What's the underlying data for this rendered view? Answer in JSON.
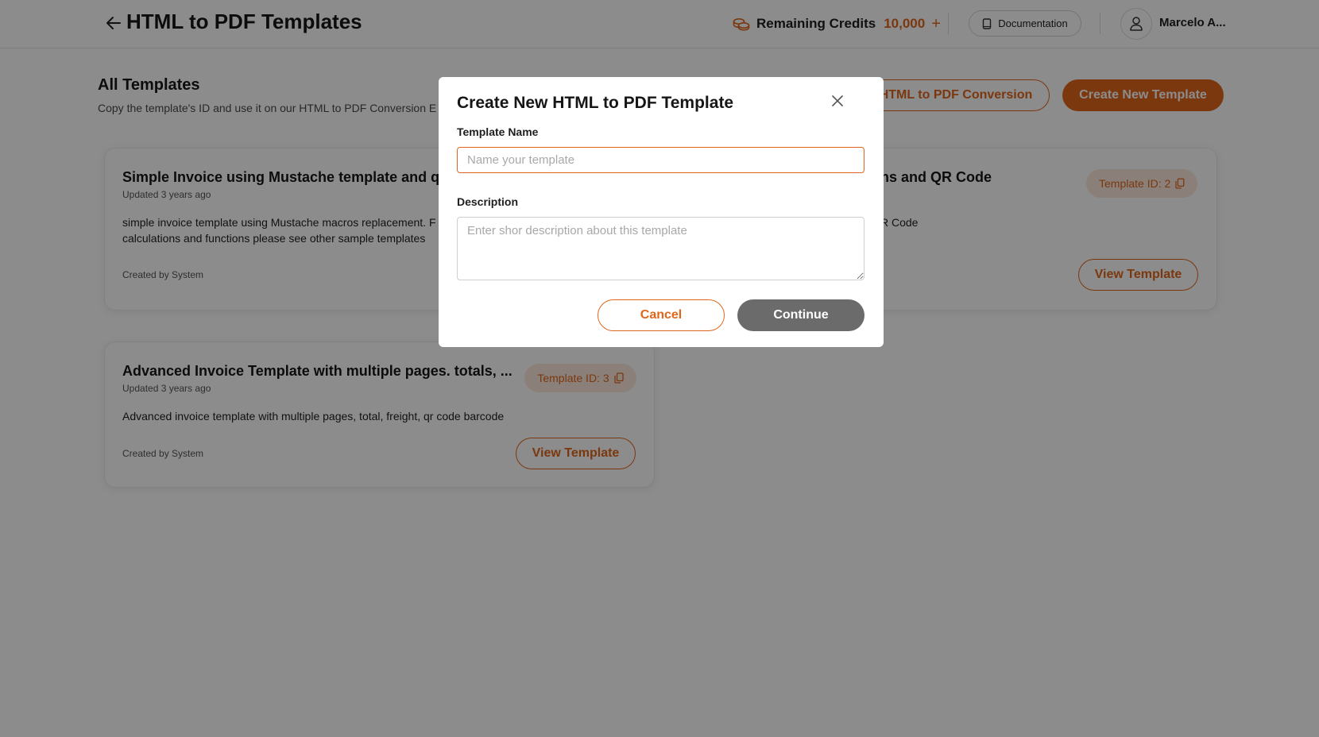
{
  "header": {
    "title": "HTML to PDF Templates",
    "credits_label": "Remaining Credits",
    "credits_value": "10,000",
    "credits_add": "+",
    "documentation_label": "Documentation",
    "user_name": "Marcelo A..."
  },
  "section": {
    "title": "All Templates",
    "subtitle": "Copy the template's ID and use it on our HTML to PDF Conversion E",
    "conversion_button": "HTML to PDF Conversion",
    "create_button": "Create New Template"
  },
  "cards": [
    {
      "title": "Simple Invoice using Mustache template and qr",
      "updated": "Updated 3 years ago",
      "description_line1": "simple invoice template using Mustache macros replacement. F",
      "description_line2": "calculations and functions please see other sample templates",
      "created_by": "Created by System"
    },
    {
      "title_visible": "ns and QR Code",
      "description_visible": "R Code",
      "id_badge": "Template ID: 2",
      "view_button": "View Template"
    },
    {
      "title": "Advanced Invoice Template with multiple pages. totals, ...",
      "updated": "Updated 3 years ago",
      "description": "Advanced invoice template with multiple pages, total, freight, qr code barcode",
      "created_by": "Created by System",
      "id_badge": "Template ID: 3",
      "view_button": "View Template"
    }
  ],
  "modal": {
    "title": "Create New HTML to PDF Template",
    "name_label": "Template Name",
    "name_placeholder": "Name your template",
    "name_value": "",
    "description_label": "Description",
    "description_placeholder": "Enter shor description about this template",
    "description_value": "",
    "cancel_label": "Cancel",
    "continue_label": "Continue"
  },
  "colors": {
    "accent": "#e1661b",
    "badge_bg": "#fbeadd",
    "continue_bg": "#6b6b6b",
    "overlay": "rgba(0,0,0,0.45)"
  },
  "icons": {
    "back": "arrow-left-icon",
    "credits": "coins-icon",
    "documentation": "book-icon",
    "avatar": "user-icon",
    "copy": "copy-icon",
    "close": "close-icon"
  }
}
